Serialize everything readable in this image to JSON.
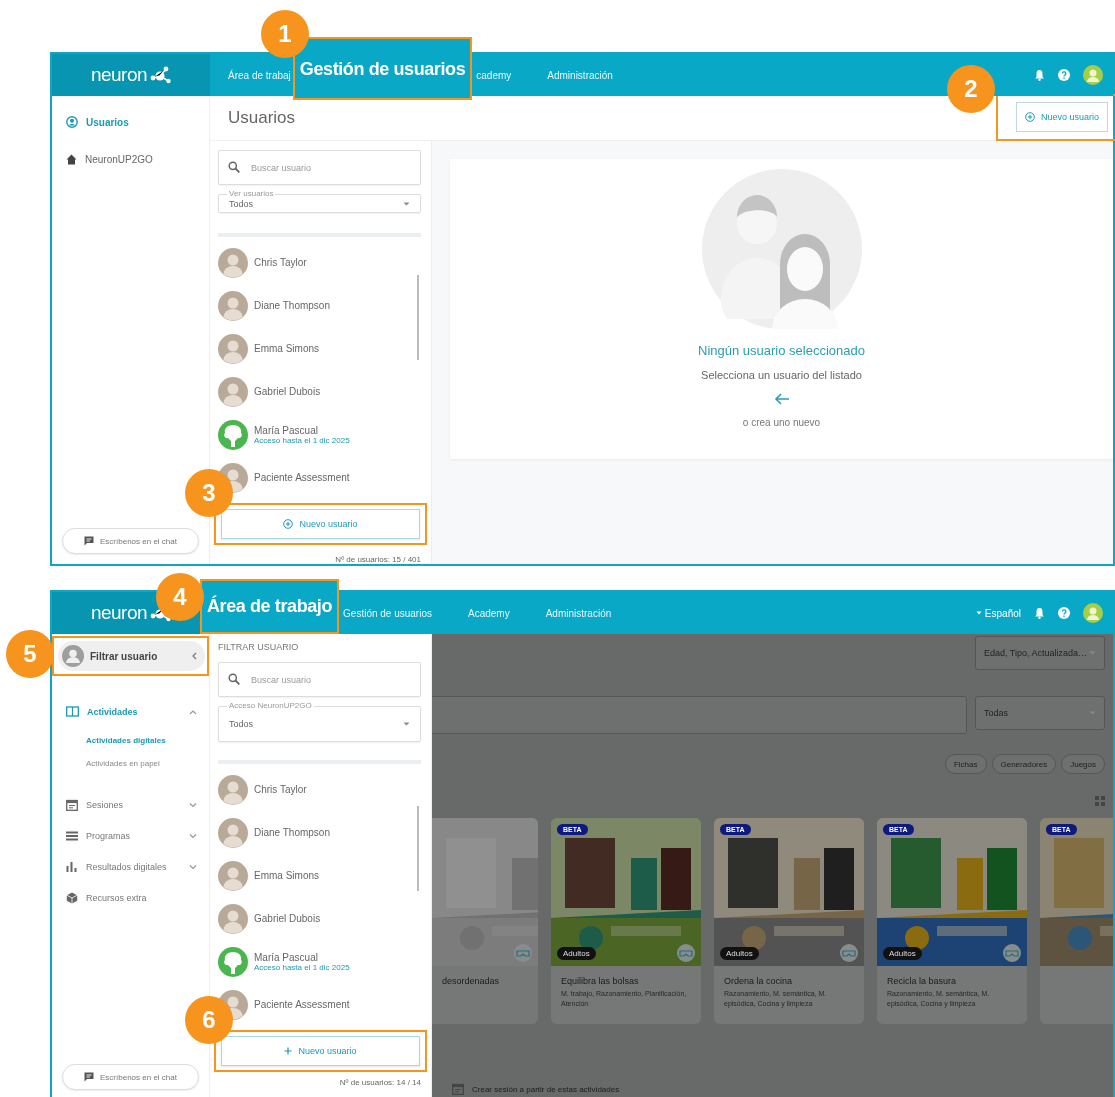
{
  "top_screen": {
    "logo": "neuron",
    "nav": [
      {
        "label": "Área de trabaj",
        "highlighted": false
      },
      {
        "label": "Gestión de usuarios",
        "highlighted": true,
        "callout": "1"
      },
      {
        "label": "cademy",
        "highlighted": false
      },
      {
        "label": "Administración",
        "highlighted": false
      }
    ],
    "sidebar": [
      {
        "label": "Usuarios",
        "selected": true
      },
      {
        "label": "NeuronUP2GO",
        "selected": false
      }
    ],
    "chat_button": "Escríbenos en el chat",
    "page_title": "Usuarios",
    "new_user_button": {
      "label": "Nuevo usuario",
      "callout": "2"
    },
    "search": {
      "placeholder": "Buscar usuario"
    },
    "filter": {
      "label": "Ver usuarios",
      "value": "Todos"
    },
    "users": [
      {
        "name": "Chris Taylor"
      },
      {
        "name": "Diane Thompson"
      },
      {
        "name": "Emma Simons"
      },
      {
        "name": "Gabriel Dubois"
      },
      {
        "name": "María Pascual",
        "kind": "brand",
        "note": "Acceso hasta el 1 dic 2025"
      },
      {
        "name": "Paciente Assessment"
      }
    ],
    "list_button": {
      "label": "Nuevo usuario",
      "callout": "3"
    },
    "count": "Nº de usuarios: 15 / 401",
    "empty_state": {
      "title": "Ningún usuario seleccionado",
      "text": "Selecciona un usuario del listado",
      "hint": "o crea uno nuevo"
    }
  },
  "bottom_screen": {
    "logo": "neuron",
    "nav": [
      {
        "label": "Área de trabajo",
        "highlighted": true,
        "callout": "4"
      },
      {
        "label": "Gestión de usuarios",
        "highlighted": false
      },
      {
        "label": "Academy",
        "highlighted": false
      },
      {
        "label": "Administración",
        "highlighted": false
      }
    ],
    "language": "Español",
    "filter_toggle": {
      "label": "Filtrar usuario",
      "callout": "5"
    },
    "menu": [
      {
        "label": "Actividades",
        "selected": true,
        "expandable": true,
        "expanded": true,
        "children": [
          {
            "label": "Actividades digitales",
            "selected": true
          },
          {
            "label": "Actividades en papel",
            "selected": false
          }
        ]
      },
      {
        "label": "Sesiones",
        "selected": false,
        "expandable": true,
        "expanded": false
      },
      {
        "label": "Programas",
        "selected": false,
        "expandable": true,
        "expanded": false
      },
      {
        "label": "Resultados digitales",
        "selected": false,
        "expandable": true,
        "expanded": false
      },
      {
        "label": "Recursos extra",
        "selected": false,
        "expandable": false,
        "expanded": false
      }
    ],
    "chat_button": "Escríbenos en el chat",
    "panel_title": "FILTRAR USUARIO",
    "search": {
      "placeholder": "Buscar usuario"
    },
    "filter": {
      "label": "Acceso NeuronUP2GO",
      "value": "Todos"
    },
    "users": [
      {
        "name": "Chris Taylor"
      },
      {
        "name": "Diane Thompson"
      },
      {
        "name": "Emma Simons"
      },
      {
        "name": "Gabriel Dubois"
      },
      {
        "name": "María Pascual",
        "kind": "brand",
        "note": "Acceso hasta el 1 dic 2025"
      },
      {
        "name": "Paciente Assessment"
      }
    ],
    "list_button": {
      "label": "Nuevo usuario",
      "callout": "6"
    },
    "count": "Nº de usuarios: 14 / 14",
    "sort_select": {
      "value": "Edad, Tipo, Actualizada…"
    },
    "type_select": {
      "value": "Todas"
    },
    "chips": [
      {
        "label": "Fichas"
      },
      {
        "label": "Generadores"
      },
      {
        "label": "Juegos"
      }
    ],
    "cards": [
      {
        "title": "desordenadas"
      },
      {
        "title": "Equilibra las bolsas",
        "subtitle": "M. trabajo, Razonamiento, Planificación, Atención",
        "badge": "BETA",
        "audience": "Adultos"
      },
      {
        "title": "Ordena la cocina",
        "subtitle": "Razonamiento, M. semántica, M. episódica, Cocina y limpieza",
        "badge": "BETA",
        "audience": "Adultos"
      },
      {
        "title": "Recicla la basura",
        "subtitle": "Razonamiento, M. semántica, M. episódica, Cocina y limpieza",
        "badge": "BETA",
        "audience": "Adultos"
      },
      {
        "badge": "BETA"
      }
    ],
    "footer_action": "Crear sesión a partir de estas actividades"
  }
}
